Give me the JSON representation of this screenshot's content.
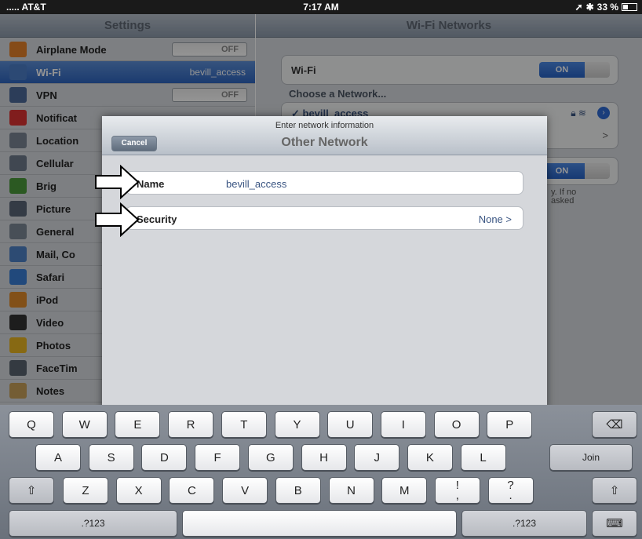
{
  "status_bar": {
    "carrier": "..... AT&T",
    "time": "7:17 AM",
    "battery": "33 %"
  },
  "settings": {
    "title": "Settings",
    "items": [
      {
        "label": "Airplane Mode",
        "value": "OFF",
        "icon": "airplane-icon",
        "color": "#e5812a"
      },
      {
        "label": "Wi-Fi",
        "value": "bevill_access",
        "icon": "wifi-icon",
        "color": "#4d7fc9"
      },
      {
        "label": "VPN",
        "value": "OFF",
        "icon": "vpn-icon",
        "color": "#4c6a9a"
      },
      {
        "label": "Notificat",
        "value": "",
        "icon": "notifications-icon",
        "color": "#d33"
      },
      {
        "label": "Location",
        "value": "",
        "icon": "location-icon",
        "color": "#7a8594"
      },
      {
        "label": "Cellular",
        "value": "",
        "icon": "cellular-icon",
        "color": "#6e7b8c"
      },
      {
        "label": "Brig",
        "value": "",
        "icon": "brightness-icon",
        "color": "#4a9a3c"
      },
      {
        "label": "Picture",
        "value": "",
        "icon": "picture-frame-icon",
        "color": "#5a6677"
      },
      {
        "label": "General",
        "value": "",
        "icon": "gear-icon",
        "color": "#7d8896"
      },
      {
        "label": "Mail, Co",
        "value": "",
        "icon": "mail-icon",
        "color": "#4f82c7"
      },
      {
        "label": "Safari",
        "value": "",
        "icon": "safari-icon",
        "color": "#3a7fd6"
      },
      {
        "label": "iPod",
        "value": "",
        "icon": "ipod-icon",
        "color": "#e08a2a"
      },
      {
        "label": "Video",
        "value": "",
        "icon": "video-icon",
        "color": "#333"
      },
      {
        "label": "Photos",
        "value": "",
        "icon": "photos-icon",
        "color": "#e8b522"
      },
      {
        "label": "FaceTim",
        "value": "",
        "icon": "facetime-icon",
        "color": "#5b6570"
      },
      {
        "label": "Notes",
        "value": "",
        "icon": "notes-icon",
        "color": "#c8a15a"
      }
    ]
  },
  "wifi_networks": {
    "title": "Wi-Fi Networks",
    "wifi_label": "Wi-Fi",
    "wifi_state": "ON",
    "choose_label": "Choose a Network...",
    "network_name": "✓ bevill_access",
    "ask_state": "ON",
    "ask_note_1": "y. If no",
    "ask_note_2": "asked"
  },
  "modal": {
    "prompt": "Enter network information",
    "title": "Other Network",
    "cancel_label": "Cancel",
    "name_label": "Name",
    "name_value": "bevill_access",
    "security_label": "Security",
    "security_value": "None >"
  },
  "keyboard": {
    "row1": [
      "Q",
      "W",
      "E",
      "R",
      "T",
      "Y",
      "U",
      "I",
      "O",
      "P"
    ],
    "row2": [
      "A",
      "S",
      "D",
      "F",
      "G",
      "H",
      "J",
      "K",
      "L"
    ],
    "row3": [
      "Z",
      "X",
      "C",
      "V",
      "B",
      "N",
      "M",
      "!\n,",
      "?\n."
    ],
    "join_label": "Join",
    "numbers_label": ".?123",
    "shift_icon": "shift-icon",
    "backspace_icon": "backspace-icon",
    "hide_keyboard_icon": "hide-keyboard-icon"
  }
}
